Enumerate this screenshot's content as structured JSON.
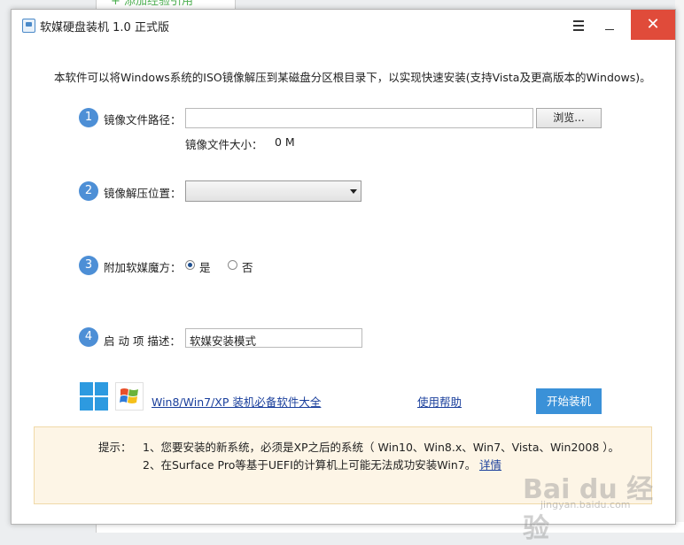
{
  "background": {
    "tab_label": "+ 添加经验引用"
  },
  "window": {
    "title": "软媒硬盘装机 1.0 正式版",
    "close_symbol": "✕"
  },
  "intro": "本软件可以将Windows系统的ISO镜像解压到某磁盘分区根目录下，以实现快速安装(支持Vista及更高版本的Windows)。",
  "steps": [
    {
      "number": "1",
      "label": "镜像文件路径："
    },
    {
      "number": "2",
      "label": "镜像解压位置："
    },
    {
      "number": "3",
      "label": "附加软媒魔方："
    },
    {
      "number": "4",
      "label": "启 动 项 描述："
    }
  ],
  "image_path": {
    "value": ""
  },
  "browse_label": "浏览...",
  "image_size": {
    "label": "镜像文件大小：",
    "value": "0 M"
  },
  "extract_location": {
    "selected": ""
  },
  "attach_cube": {
    "options": [
      {
        "label": "是",
        "checked": true
      },
      {
        "label": "否",
        "checked": false
      }
    ]
  },
  "boot_description": {
    "value": "软媒安装模式"
  },
  "links": {
    "software_collection": "Win8/Win7/XP 装机必备软件大全",
    "help": "使用帮助"
  },
  "start_button": "开始装机",
  "notice": {
    "title": "提示：",
    "line1": "1、您要安装的新系统，必须是XP之后的系统（ Win10、Win8.x、Win7、Vista、Win2008 ）。",
    "line2": "2、在Surface Pro等基于UEFI的计算机上可能无法成功安装Win7。",
    "details_link": "详情"
  },
  "watermark": {
    "main": "Bai du 经验",
    "sub": "jingyan.baidu.com"
  },
  "colors": {
    "accent_blue": "#3a91d8",
    "step_blue": "#4d8fd6",
    "close_red": "#e04b3a",
    "link_blue": "#1a3f9c",
    "notice_bg": "#fdf5e6"
  },
  "icons": {
    "app": "app-disk-icon",
    "menu": "hamburger-menu-icon",
    "minimize": "minimize-icon",
    "close": "close-icon",
    "win8": "windows8-logo-icon",
    "xp": "windows-xp-logo-icon"
  }
}
